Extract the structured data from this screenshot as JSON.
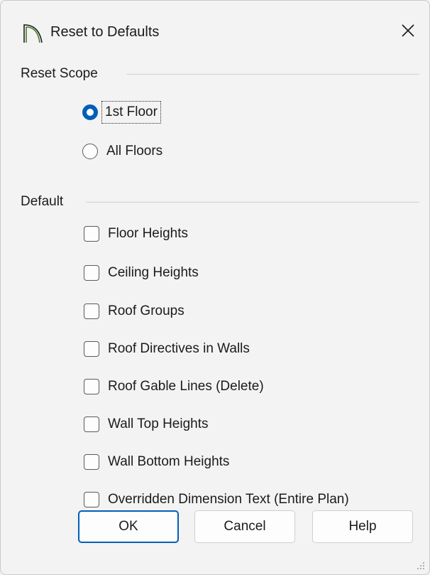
{
  "window": {
    "title": "Reset to Defaults",
    "close_glyph": "✕"
  },
  "reset_scope": {
    "label": "Reset Scope",
    "options": [
      {
        "label": "1st Floor",
        "selected": true
      },
      {
        "label": "All Floors",
        "selected": false
      }
    ]
  },
  "default_group": {
    "label": "Default",
    "items": [
      {
        "label": "Floor Heights",
        "checked": false
      },
      {
        "label": "Ceiling Heights",
        "checked": false
      },
      {
        "label": "Roof Groups",
        "checked": false
      },
      {
        "label": "Roof Directives in Walls",
        "checked": false
      },
      {
        "label": "Roof Gable Lines (Delete)",
        "checked": false
      },
      {
        "label": "Wall Top Heights",
        "checked": false
      },
      {
        "label": "Wall Bottom Heights",
        "checked": false
      },
      {
        "label": "Overridden Dimension Text (Entire Plan)",
        "checked": false
      }
    ]
  },
  "buttons": {
    "ok": "OK",
    "cancel": "Cancel",
    "help": "Help"
  },
  "colors": {
    "accent": "#005fb8",
    "background": "#f3f3f3",
    "icon_green": "#4a7a2a"
  }
}
